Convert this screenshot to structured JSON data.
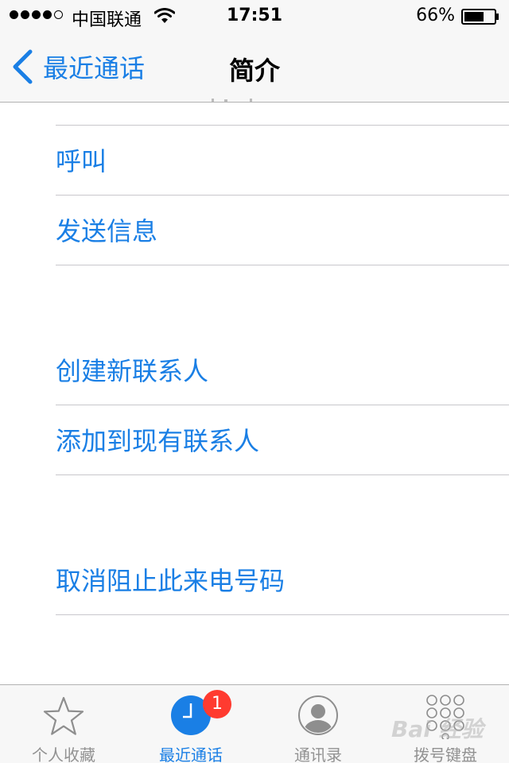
{
  "status_bar": {
    "carrier": "中国联通",
    "time": "17:51",
    "battery": "66%",
    "signal_bars": 4,
    "signal_max": 5,
    "battery_level": 0.66
  },
  "nav": {
    "back_label": "最近通话",
    "title": "简介"
  },
  "actions": {
    "call": "呼叫",
    "send_message": "发送信息",
    "create_contact": "创建新联系人",
    "add_to_existing": "添加到现有联系人",
    "unblock": "取消阻止此来电号码"
  },
  "tab_bar": {
    "tabs": [
      {
        "label": "个人收藏",
        "icon": "star-icon"
      },
      {
        "label": "最近通话",
        "icon": "clock-icon",
        "active": true,
        "badge": "1"
      },
      {
        "label": "通讯录",
        "icon": "contacts-icon"
      },
      {
        "label": "拨号键盘",
        "icon": "keypad-icon"
      }
    ]
  },
  "watermark": "Bai 经验",
  "colors": {
    "accent": "#1a7fe5",
    "badge": "#ff3b30",
    "inactive": "#929292"
  }
}
